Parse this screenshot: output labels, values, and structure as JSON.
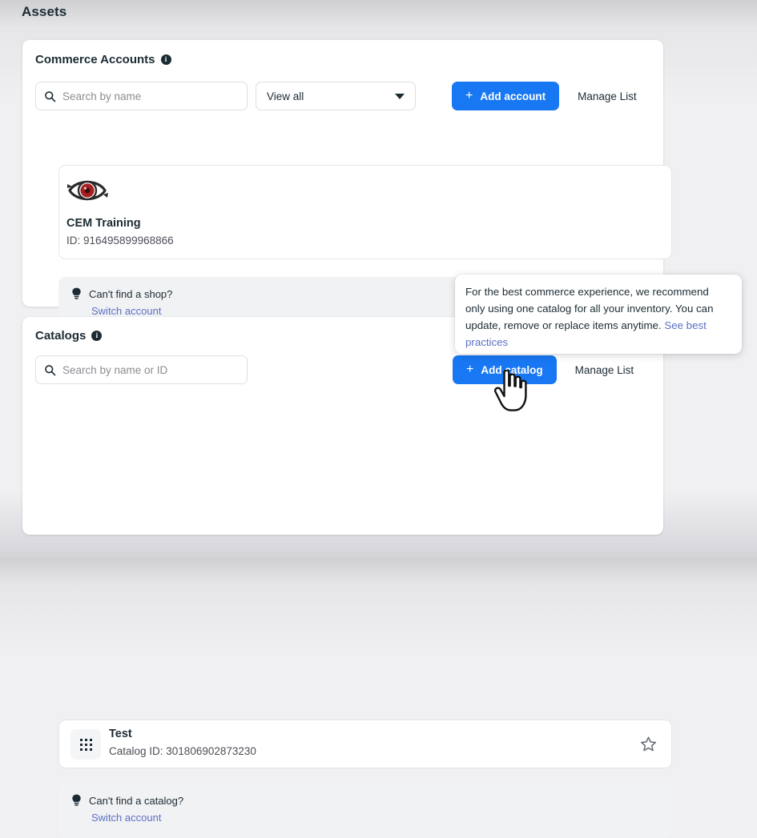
{
  "page": {
    "title": "Assets",
    "accent_color": "#1877f2",
    "link_color": "#5c6fc5",
    "text_color": "#1c2b33"
  },
  "accounts_section": {
    "heading": "Commerce Accounts",
    "info_icon": "info-icon",
    "info_glyph": "i",
    "search": {
      "placeholder": "Search by name",
      "value": "",
      "icon": "search-icon"
    },
    "filter": {
      "selected": "View all",
      "icon": "chevron-down-icon",
      "options": [
        "View all"
      ]
    },
    "add_button": {
      "label": "Add account",
      "icon": "plus-icon",
      "glyph": "+"
    },
    "manage_button": {
      "label": "Manage List"
    },
    "account": {
      "logo": "eye-logo",
      "name": "CEM Training",
      "id_label": "ID: 916495899968866"
    },
    "tip": {
      "icon": "lightbulb-icon",
      "question": "Can't find a shop?",
      "link": "Switch account"
    }
  },
  "catalogs_section": {
    "heading": "Catalogs",
    "info_icon": "info-icon",
    "info_glyph": "i",
    "search": {
      "placeholder": "Search by name or ID",
      "value": "",
      "icon": "search-icon"
    },
    "add_button": {
      "label": "Add catalog",
      "icon": "plus-icon",
      "glyph": "+"
    },
    "manage_button": {
      "label": "Manage List"
    },
    "catalog": {
      "thumb_icon": "grid-dots-icon",
      "name": "Test",
      "id_label": "Catalog ID: 301806902873230",
      "favorite_icon": "star-outline-icon"
    },
    "tip": {
      "icon": "lightbulb-icon",
      "question": "Can't find a catalog?",
      "link": "Switch account"
    }
  },
  "tooltip": {
    "body": "For the best commerce experience, we recommend only using one catalog for all your inventory. You can update, remove or replace items anytime. ",
    "link": "See best practices"
  },
  "cursor": {
    "type": "pointing-hand-cursor"
  }
}
